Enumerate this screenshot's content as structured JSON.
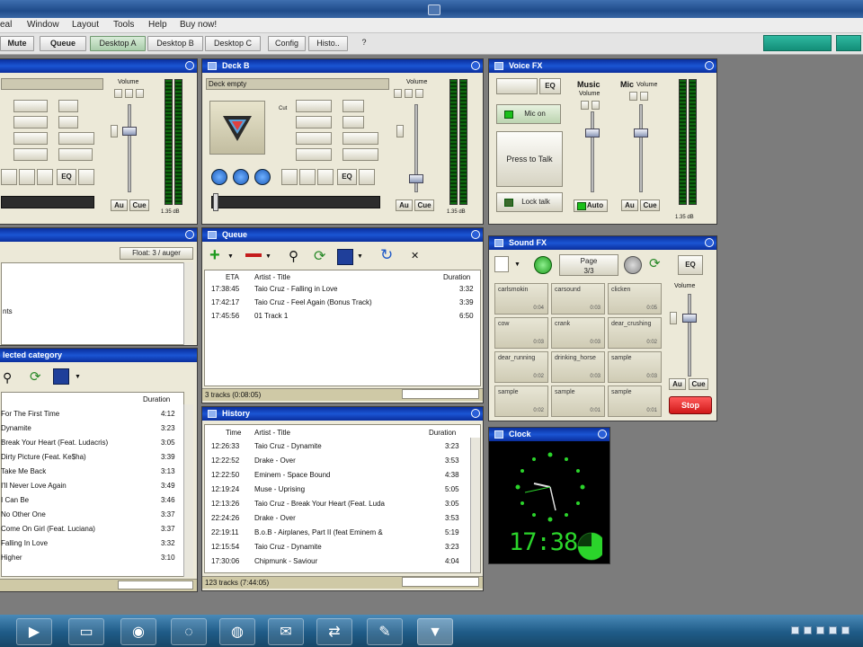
{
  "menubar": {
    "items": [
      "eal",
      "Window",
      "Layout",
      "Tools",
      "Help",
      "Buy now!"
    ]
  },
  "toolbar": {
    "mute_label": "Mute",
    "queue_label": "Queue",
    "tabs": [
      "Desktop A",
      "Desktop B",
      "Desktop C",
      "Config",
      "Histo..",
      "?"
    ]
  },
  "deck_a": {
    "volume_label": "Volume",
    "eq_label": "EQ",
    "auto_label": "Au",
    "cue_label": "Cue",
    "db_label": "1.35 dB"
  },
  "deck_b": {
    "title": "Deck B",
    "track": "Deck empty",
    "volume_label": "Volume",
    "eq_label": "EQ",
    "auto_label": "Au",
    "cue_label": "Cue",
    "db_label": "1.35 dB"
  },
  "voice_fx": {
    "title": "Voice FX",
    "eq_label": "EQ",
    "mic_on": "Mic on",
    "press_to_talk": "Press to Talk",
    "lock_talk": "Lock talk",
    "music_label": "Music",
    "mic_label": "Mic",
    "volume_label": "Volume",
    "auto_label": "Auto",
    "au_label": "Au",
    "cue_label": "Cue",
    "db_label": "1.35 dB"
  },
  "browser": {
    "float_label": "Float: 3 / auger",
    "text": "nts"
  },
  "queue": {
    "title": "Queue",
    "col_eta": "ETA",
    "col_title": "Artist - Title",
    "col_duration": "Duration",
    "rows": [
      {
        "eta": "17:38:45",
        "title": "Taio Cruz - Falling in Love",
        "duration": "3:32"
      },
      {
        "eta": "17:42:17",
        "title": "Taio Cruz - Feel Again (Bonus Track)",
        "duration": "3:39"
      },
      {
        "eta": "17:45:56",
        "title": "01 Track 1",
        "duration": "6:50"
      }
    ],
    "status": "3 tracks (0:08:05)"
  },
  "category": {
    "title": "lected category",
    "col_duration": "Duration",
    "rows": [
      {
        "title": "For The First Time",
        "duration": "4:12"
      },
      {
        "title": "Dynamite",
        "duration": "3:23"
      },
      {
        "title": "Break Your Heart (Feat. Ludacris)",
        "duration": "3:05"
      },
      {
        "title": "Dirty Picture (Feat. Ke$ha)",
        "duration": "3:39"
      },
      {
        "title": "Take Me Back",
        "duration": "3:13"
      },
      {
        "title": "I'll Never Love Again",
        "duration": "3:49"
      },
      {
        "title": "I Can Be",
        "duration": "3:46"
      },
      {
        "title": "No Other One",
        "duration": "3:37"
      },
      {
        "title": "Come On Girl (Feat. Luciana)",
        "duration": "3:37"
      },
      {
        "title": "Falling In Love",
        "duration": "3:32"
      },
      {
        "title": "Higher",
        "duration": "3:10"
      }
    ]
  },
  "history": {
    "title": "History",
    "col_time": "Time",
    "col_title": "Artist - Title",
    "col_duration": "Duration",
    "rows": [
      {
        "time": "12:26:33",
        "title": "Taio Cruz - Dynamite",
        "duration": "3:23"
      },
      {
        "time": "12:22:52",
        "title": "Drake - Over",
        "duration": "3:53"
      },
      {
        "time": "12:22:50",
        "title": "Eminem - Space Bound",
        "duration": "4:38"
      },
      {
        "time": "12:19:24",
        "title": "Muse - Uprising",
        "duration": "5:05"
      },
      {
        "time": "12:13:26",
        "title": "Taio Cruz - Break Your Heart (Feat. Luda",
        "duration": "3:05"
      },
      {
        "time": "22:24:26",
        "title": "Drake - Over",
        "duration": "3:53"
      },
      {
        "time": "22:19:11",
        "title": "B.o.B - Airplanes, Part II (feat Eminem &",
        "duration": "5:19"
      },
      {
        "time": "12:15:54",
        "title": "Taio Cruz - Dynamite",
        "duration": "3:23"
      },
      {
        "time": "17:30:06",
        "title": "Chipmunk - Saviour",
        "duration": "4:04"
      }
    ],
    "status": "123 tracks (7:44:05)"
  },
  "sound_fx": {
    "title": "Sound FX",
    "page_label": "Page",
    "page_value": "3/3",
    "eq_label": "EQ",
    "volume_label": "Volume",
    "au_label": "Au",
    "cue_label": "Cue",
    "stop_label": "Stop",
    "buttons": [
      {
        "name": "carlsmokin",
        "time": "0:04"
      },
      {
        "name": "carsound",
        "time": "0:03"
      },
      {
        "name": "clicken",
        "time": "0:05"
      },
      {
        "name": "cow",
        "time": "0:03"
      },
      {
        "name": "crank",
        "time": "0:03"
      },
      {
        "name": "dear_crushing",
        "time": "0:02"
      },
      {
        "name": "dear_running",
        "time": "0:02"
      },
      {
        "name": "drinking_horse",
        "time": "0:03"
      },
      {
        "name": "sample",
        "time": "0:03"
      },
      {
        "name": "sample",
        "time": "0:02"
      },
      {
        "name": "sample",
        "time": "0:01"
      },
      {
        "name": "sample",
        "time": "0:01"
      }
    ]
  },
  "clock": {
    "title": "Clock",
    "time": "17:38"
  }
}
